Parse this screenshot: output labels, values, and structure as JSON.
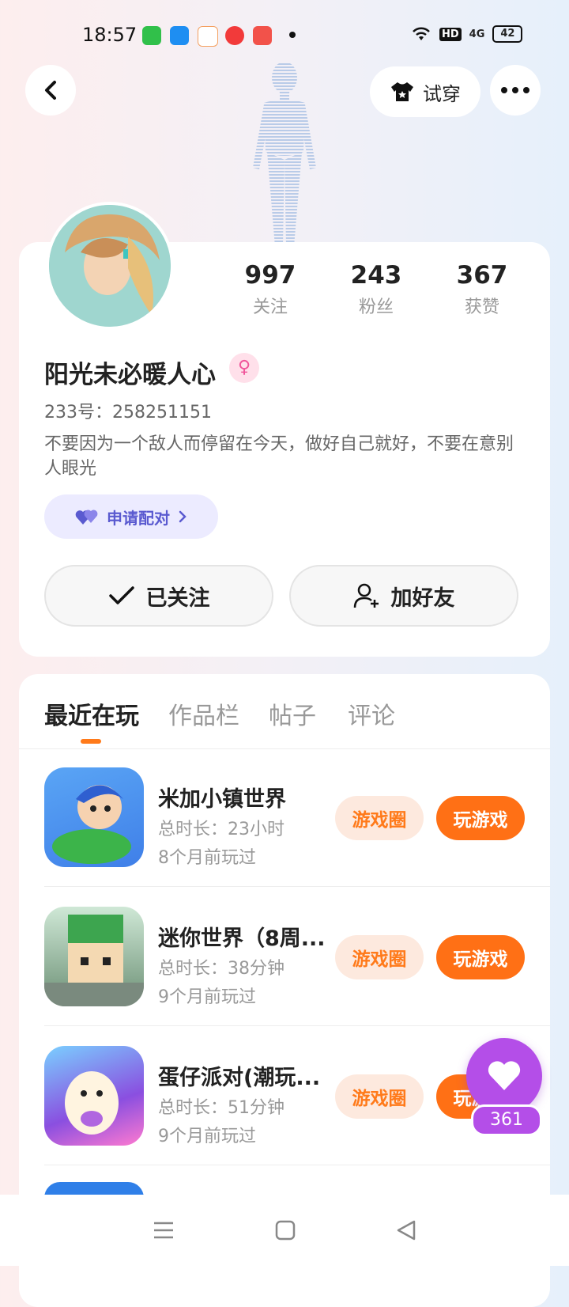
{
  "status_bar": {
    "time": "18:57",
    "battery": "42",
    "network": "4G",
    "hd": "HD"
  },
  "header": {
    "try_on_label": "试穿"
  },
  "profile": {
    "stats": [
      {
        "value": "997",
        "label": "关注"
      },
      {
        "value": "243",
        "label": "粉丝"
      },
      {
        "value": "367",
        "label": "获赞"
      }
    ],
    "nickname": "阳光未必暖人心",
    "gender_symbol": "♀",
    "uid": "233号：258251151",
    "bio": "不要因为一个敌人而停留在今天，做好自己就好，不要在意别人眼光",
    "pair_label": "申请配对",
    "followed_label": "已关注",
    "add_friend_label": "加好友"
  },
  "tabs": [
    "最近在玩",
    "作品栏",
    "帖子",
    "评论"
  ],
  "games": [
    {
      "name": "米加小镇世界",
      "duration": "总时长：23小时",
      "last_played": "8个月前玩过",
      "circle_label": "游戏圈",
      "play_label": "玩游戏"
    },
    {
      "name": "迷你世界（8周...",
      "duration": "总时长：38分钟",
      "last_played": "9个月前玩过",
      "circle_label": "游戏圈",
      "play_label": "玩游戏"
    },
    {
      "name": "蛋仔派对(潮玩...",
      "duration": "总时长：51分钟",
      "last_played": "9个月前玩过",
      "circle_label": "游戏圈",
      "play_label": "玩游戏"
    }
  ],
  "like_fab": {
    "count": "361"
  },
  "colors": {
    "accent": "#ff7015",
    "purple": "#b44ee8",
    "pair": "#5a5ad0"
  }
}
